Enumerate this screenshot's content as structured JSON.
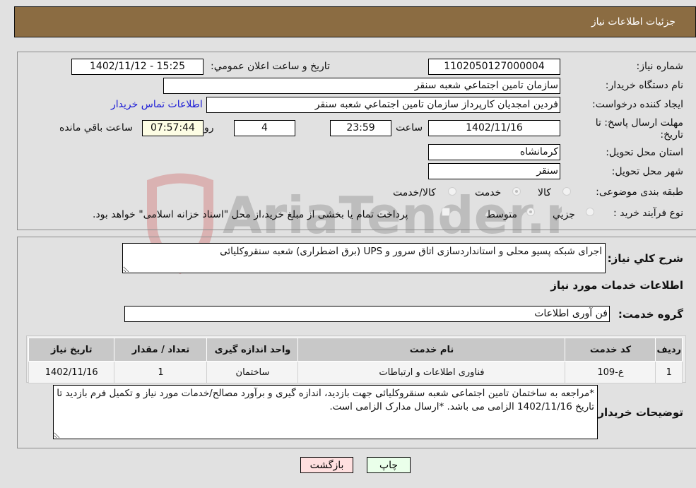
{
  "header": {
    "title": "جزئیات اطلاعات نیاز"
  },
  "info": {
    "need_number_label": "شماره نیاز:",
    "need_number": "1102050127000004",
    "announce_label": "تاريخ و ساعت اعلان عمومي:",
    "announce_value": "1402/11/12 - 15:25",
    "buyer_org_label": "نام دستگاه خريدار:",
    "buyer_org": "سازمان تامين اجتماعي شعبه سنقر",
    "creator_label": "ايجاد کننده درخواست:",
    "creator": "فردين  امجديان کارپرداز سازمان تامين اجتماعي شعبه سنقر",
    "contact_link": "اطلاعات تماس خريدار",
    "deadline_label": "مهلت ارسال پاسخ: تا تاريخ:",
    "deadline_date": "1402/11/16",
    "time_label": "ساعت",
    "deadline_time": "23:59",
    "days_value": "4",
    "days_label": "روز و",
    "remaining_time": "07:57:44",
    "remaining_label": "ساعت باقي مانده",
    "province_label": "استان محل تحويل:",
    "province": "کرمانشاه",
    "city_label": "شهر محل تحويل:",
    "city": "سنقر",
    "category_label": "طبقه بندی موضوعی:",
    "category_options": [
      "کالا",
      "خدمت",
      "کالا/خدمت"
    ],
    "category_selected": "خدمت",
    "process_label": "نوع فرآيند خريد :",
    "process_options": [
      "جزيي",
      "متوسط"
    ],
    "process_selected": "متوسط",
    "treasury_note": "پرداخت تمام يا بخشی از مبلغ خريد،از محل \"اسناد خزانه اسلامی\" خواهد بود."
  },
  "details": {
    "summary_label": "شرح کلي نياز:",
    "summary": "اجرای شبکه پسیو محلی و استانداردسازی اتاق سرور و UPS (برق اضطراری) شعبه سنقروکلیائی",
    "services_heading": "اطلاعات خدمات مورد نياز",
    "service_group_label": "گروه خدمت:",
    "service_group": "فن آوری اطلاعات",
    "table": {
      "headers": [
        "رديف",
        "کد خدمت",
        "نام خدمت",
        "واحد اندازه گيری",
        "تعداد / مقدار",
        "تاريخ نياز"
      ],
      "rows": [
        [
          "1",
          "ع-109",
          "فناوری اطلاعات و ارتباطات",
          "ساختمان",
          "1",
          "1402/11/16"
        ]
      ]
    },
    "buyer_notes_label": "توضيحات خريدار:",
    "buyer_notes": "*مراجعه به ساختمان تامین اجتماعی شعبه سنقروکلیائی جهت بازدید، اندازه گیری و برآورد مصالح/خدمات مورد نیاز و تکمیل فرم بازدید تا تاریخ 1402/11/16 الزامی می باشد. *ارسال مدارک الزامی است."
  },
  "buttons": {
    "print": "چاپ",
    "back": "بازگشت"
  },
  "watermark": {
    "text": "AriaTender.neT"
  },
  "colors": {
    "header_bg": "#8b6c42",
    "print_bg": "#eaffea",
    "back_bg": "#ffe0e0",
    "link": "#1a1ad6"
  }
}
